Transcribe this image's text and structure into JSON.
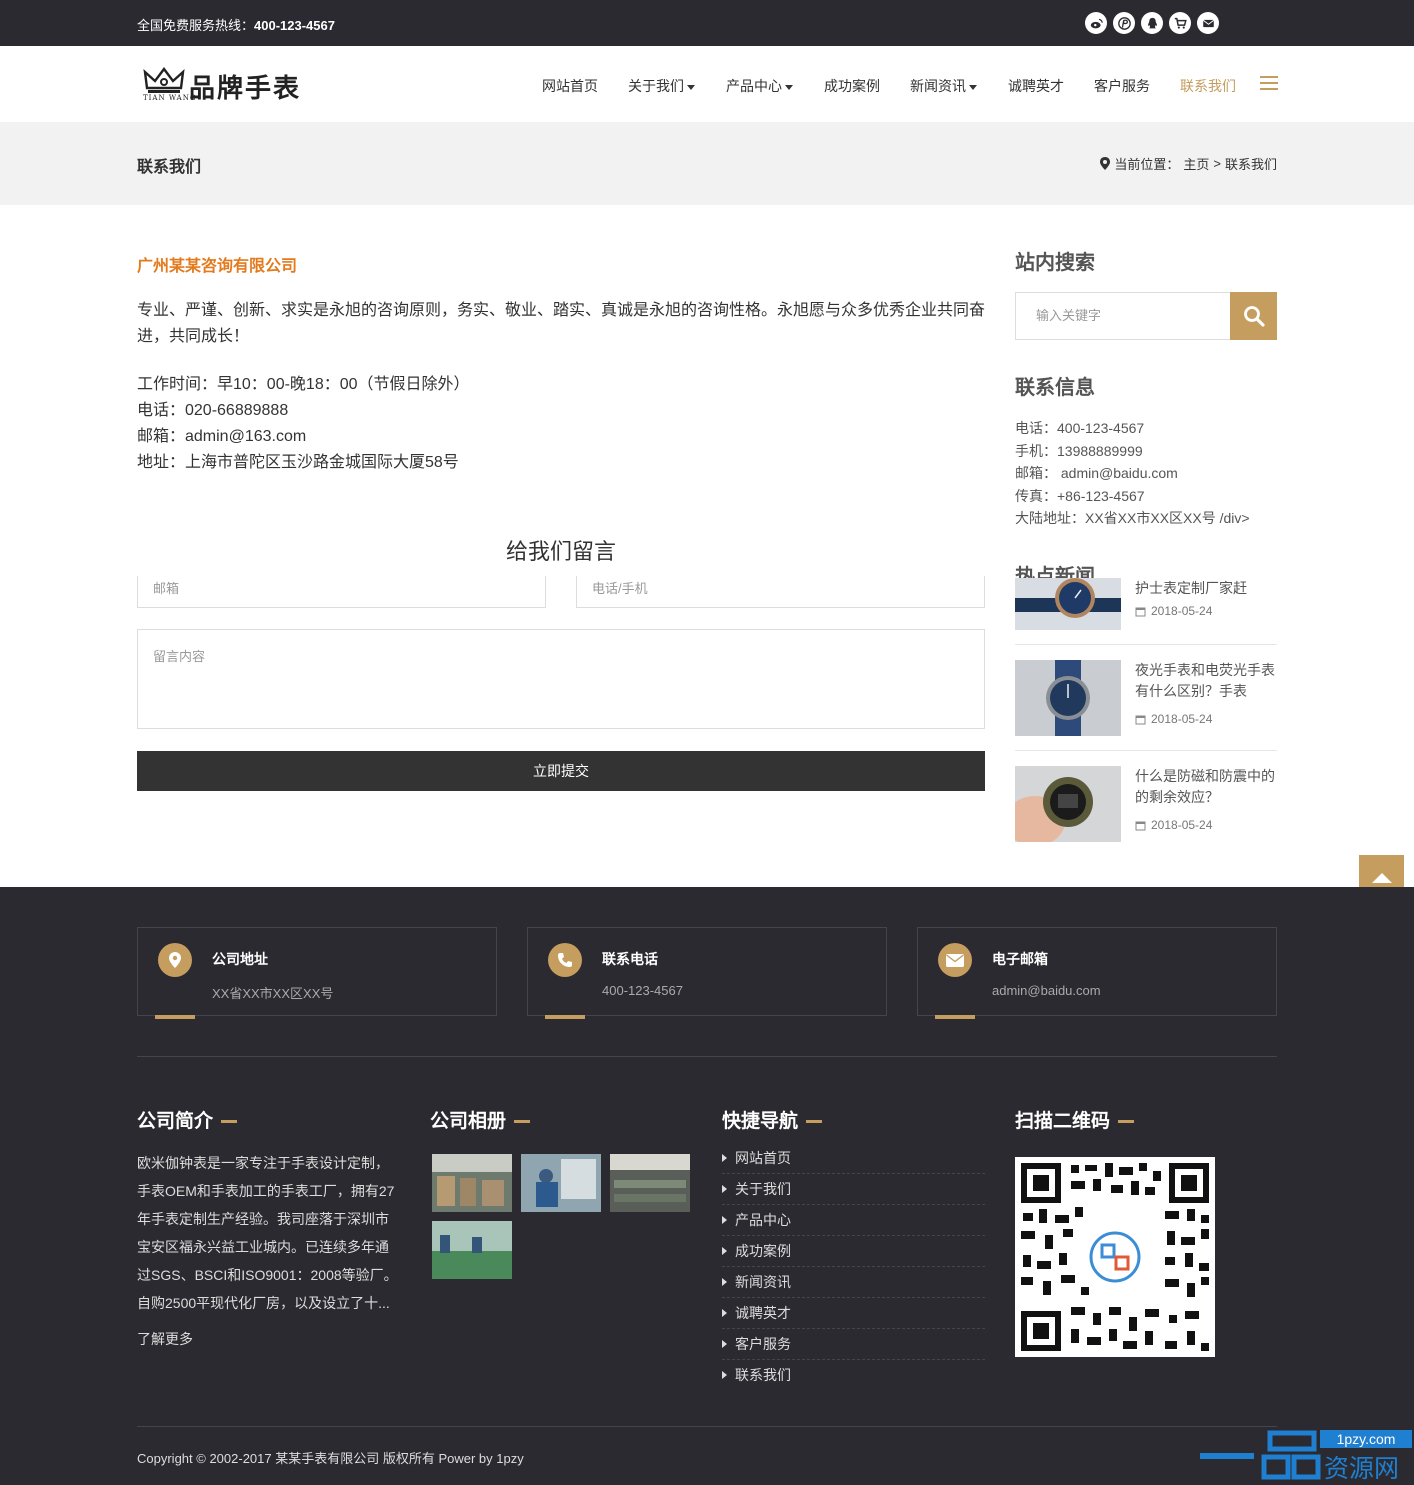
{
  "topbar": {
    "hotline_label": "全国免费服务热线：",
    "hotline_number": "400-123-4567",
    "social_icons": [
      "weibo-icon",
      "pinterest-icon",
      "qq-icon",
      "cart-icon",
      "mail-icon"
    ]
  },
  "header": {
    "brand": "品牌手表",
    "brand_sub": "TIAN WANG",
    "nav": [
      {
        "label": "网站首页"
      },
      {
        "label": "关于我们"
      },
      {
        "label": "产品中心"
      },
      {
        "label": "成功案例"
      },
      {
        "label": "新闻资讯"
      },
      {
        "label": "诚聘英才"
      },
      {
        "label": "客户服务"
      },
      {
        "label": "联系我们"
      }
    ]
  },
  "band": {
    "title": "联系我们",
    "crumb_label": "当前位置：",
    "crumb_home": "主页",
    "crumb_sep": ">",
    "crumb_current": "联系我们"
  },
  "main": {
    "company": "广州某某咨询有限公司",
    "intro": "专业、严谨、创新、求实是永旭的咨询原则，务实、敬业、踏实、真诚是永旭的咨询性格。永旭愿与众多优秀企业共同奋进，共同成长！",
    "lines": [
      "工作时间：早10：00-晚18：00（节假日除外）",
      "电话：020-66889888",
      "邮箱：admin@163.com",
      "地址：上海市普陀区玉沙路金城国际大厦58号"
    ],
    "form_title": "给我们留言",
    "email_placeholder": "邮箱",
    "phone_placeholder": "电话/手机",
    "message_placeholder": "留言内容",
    "submit": "立即提交"
  },
  "sidebar": {
    "search_title": "站内搜索",
    "search_placeholder": "输入关键字",
    "contact_title": "联系信息",
    "contact_lines": [
      "电话：400-123-4567",
      "手机：13988889999",
      "邮箱： admin@baidu.com",
      "传真：+86-123-4567",
      "大陆地址：XX省XX市XX区XX号 /div>"
    ],
    "news_title": "热点新闻",
    "news": [
      {
        "title": "护士表定制厂家赶",
        "date": "2018-05-24"
      },
      {
        "title": "夜光手表和电荧光手表有什么区别？手表",
        "date": "2018-05-24"
      },
      {
        "title": "什么是防磁和防震中的的剩余效应？",
        "date": "2018-05-24"
      }
    ]
  },
  "footer": {
    "cards": [
      {
        "title": "公司地址",
        "value": "XX省XX市XX区XX号",
        "icon": "map-pin-icon"
      },
      {
        "title": "联系电话",
        "value": "400-123-4567",
        "icon": "phone-icon"
      },
      {
        "title": "电子邮箱",
        "value": "admin@baidu.com",
        "icon": "envelope-icon"
      }
    ],
    "about_title": "公司简介",
    "about_text": "欧米伽钟表是一家专注于手表设计定制，手表OEM和手表加工的手表工厂，拥有27年手表定制生产经验。我司座落于深圳市宝安区福永兴益工业城内。已连续多年通过SGS、BSCI和ISO9001：2008等验厂。自购2500平现代化厂房，以及设立了十...",
    "more": "了解更多",
    "album_title": "公司相册",
    "nav_title": "快捷导航",
    "nav_links": [
      "网站首页",
      "关于我们",
      "产品中心",
      "成功案例",
      "新闻资讯",
      "诚聘英才",
      "客户服务",
      "联系我们"
    ],
    "qr_title": "扫描二维码",
    "copyright": "Copyright © 2002-2017 某某手表有限公司 版权所有 Power by 1pzy",
    "watermark_url": "1pzy.com",
    "watermark_text": "资源网"
  },
  "colors": {
    "accent": "#c59d5f",
    "dark": "#2b2a30",
    "company": "#e37b1e"
  }
}
